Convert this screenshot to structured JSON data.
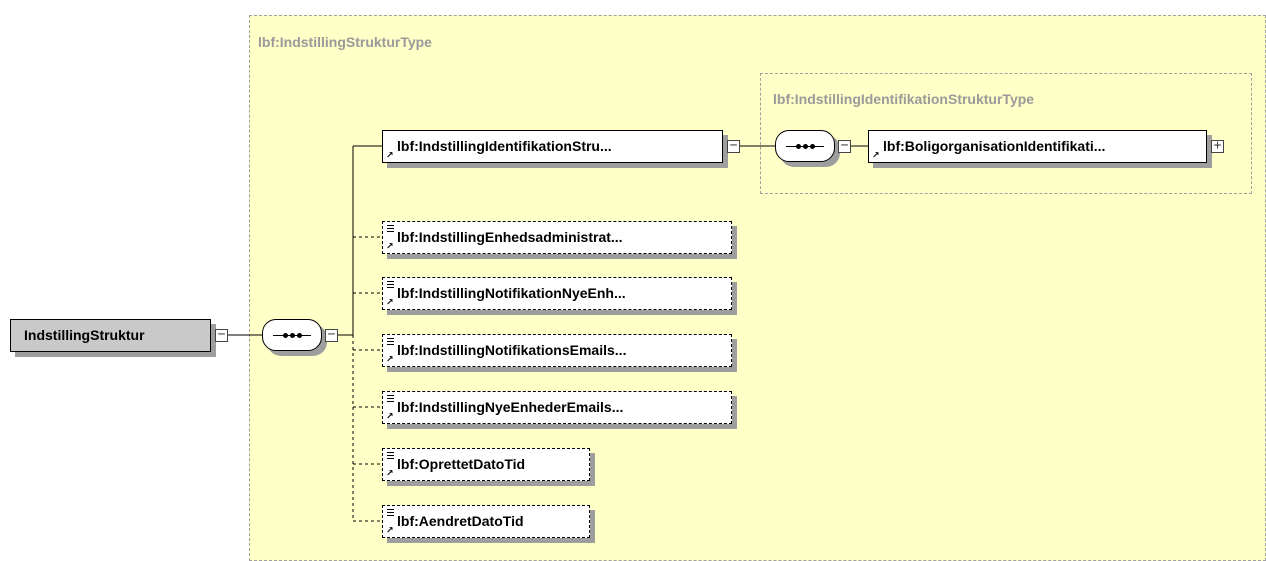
{
  "root_element": "IndstillingStruktur",
  "outer_type": "lbf:IndstillingStrukturType",
  "inner_type": "lbf:IndstillingIdentifikationStrukturType",
  "children": [
    {
      "label": "lbf:IndstillingIdentifikationStru...",
      "optional": false
    },
    {
      "label": "lbf:IndstillingEnhedsadministrat...",
      "optional": true
    },
    {
      "label": "lbf:IndstillingNotifikationNyeEnh...",
      "optional": true
    },
    {
      "label": "lbf:IndstillingNotifikationsEmails...",
      "optional": true
    },
    {
      "label": "lbf:IndstillingNyeEnhederEmails...",
      "optional": true
    },
    {
      "label": "lbf:OprettetDatoTid",
      "optional": true
    },
    {
      "label": "lbf:AendretDatoTid",
      "optional": true
    }
  ],
  "inner_child": {
    "label": "lbf:BoligorganisationIdentifikati..."
  },
  "colors": {
    "type_box_fill": "#ffffc8",
    "root_fill": "#c9c9c9",
    "shadow": "#9e9e9e"
  }
}
